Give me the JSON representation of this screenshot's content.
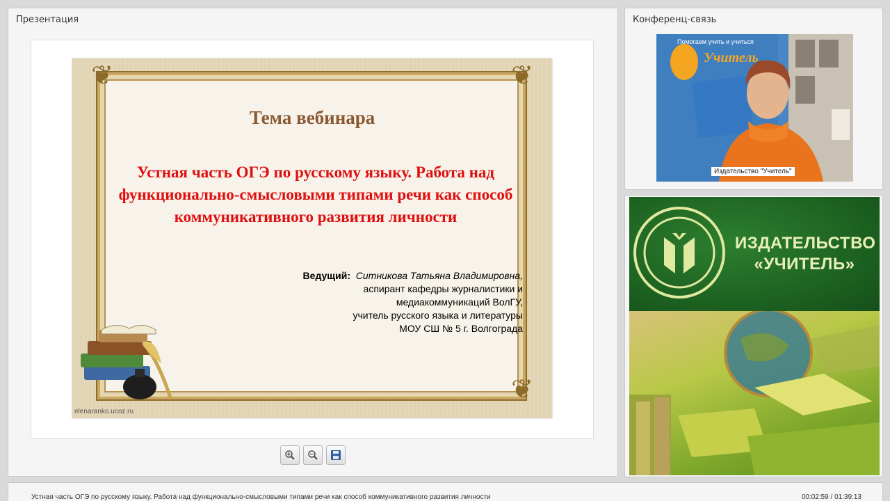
{
  "presentation_panel": {
    "title": "Презентация"
  },
  "slide": {
    "heading": "Тема вебинара",
    "title": "Устная часть ОГЭ по русскому языку. Работа над функционально-смысловыми типами речи как способ коммуникативного развития личности",
    "presenter_role": "Ведущий:",
    "presenter_name": "Ситникова Татьяна Владимировна,",
    "presenter_lines": [
      "аспирант кафедры журналистики и",
      "медиакоммуникаций ВолГУ,",
      "учитель русского языка и литературы",
      "МОУ СШ № 5 г. Волгограда"
    ],
    "watermark": "elenaranko.ucoz.ru"
  },
  "toolbar": {
    "zoom_in_icon": "zoom-in-icon",
    "zoom_out_icon": "zoom-out-icon",
    "save_icon": "save-icon"
  },
  "conference_panel": {
    "title": "Конференц-связь",
    "video_label": "Издательство \"Учитель\"",
    "banner_text_top": "Помогаем учить и учиться",
    "banner_brand": "Учитель"
  },
  "ad_panel": {
    "line1": "ИЗДАТЕЛЬСТВО",
    "line2": "«УЧИТЕЛЬ»"
  },
  "status_bar": {
    "title": "Устная часть ОГЭ по русскому языку.  Работа над функционально-смысловыми типами речи как способ коммуникативного развития личности",
    "time": "00:02:59 / 01:39:13"
  },
  "colors": {
    "slide_title": "#e00f0f",
    "slide_heading": "#8a5a32",
    "ad_green": "#1b5e1f",
    "ad_text": "#e8f0b8"
  }
}
